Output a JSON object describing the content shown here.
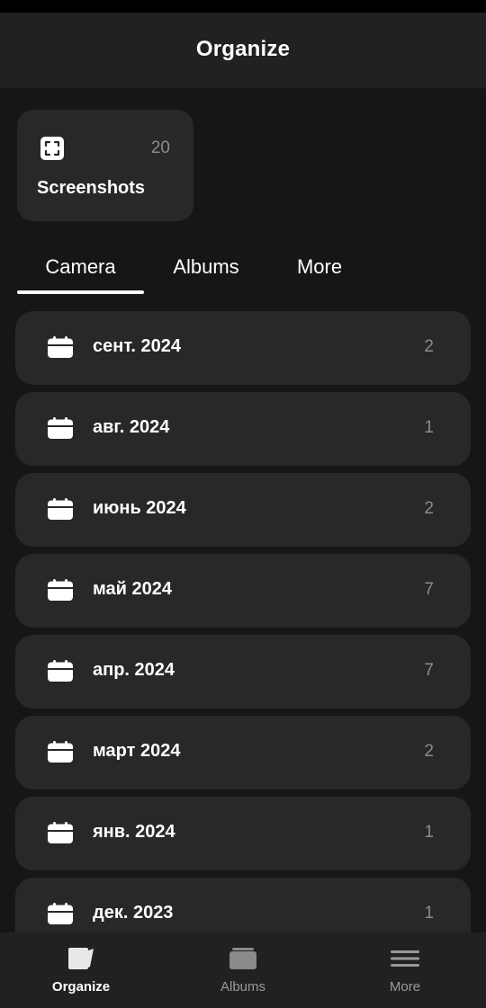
{
  "header": {
    "title": "Organize"
  },
  "shortcut": {
    "label": "Screenshots",
    "count": "20",
    "icon": "screenshot-icon"
  },
  "tabs": [
    {
      "label": "Camera",
      "selected": true
    },
    {
      "label": "Albums",
      "selected": false
    },
    {
      "label": "More",
      "selected": false
    }
  ],
  "months": [
    {
      "label": "сент. 2024",
      "count": "2",
      "icon": "calendar-icon"
    },
    {
      "label": "авг. 2024",
      "count": "1",
      "icon": "calendar-icon"
    },
    {
      "label": "июнь 2024",
      "count": "2",
      "icon": "calendar-icon"
    },
    {
      "label": "май 2024",
      "count": "7",
      "icon": "calendar-icon"
    },
    {
      "label": "апр. 2024",
      "count": "7",
      "icon": "calendar-icon"
    },
    {
      "label": "март 2024",
      "count": "2",
      "icon": "calendar-icon"
    },
    {
      "label": "янв. 2024",
      "count": "1",
      "icon": "calendar-icon"
    },
    {
      "label": "дек. 2023",
      "count": "1",
      "icon": "calendar-icon"
    }
  ],
  "bottom_nav": [
    {
      "label": "Organize",
      "icon": "organize-icon",
      "active": true
    },
    {
      "label": "Albums",
      "icon": "albums-icon",
      "active": false
    },
    {
      "label": "More",
      "icon": "menu-icon",
      "active": false
    }
  ],
  "colors": {
    "background": "#161616",
    "surface": "#282828",
    "bar": "#212121",
    "text": "#ffffff",
    "muted": "#8c8c8c"
  }
}
